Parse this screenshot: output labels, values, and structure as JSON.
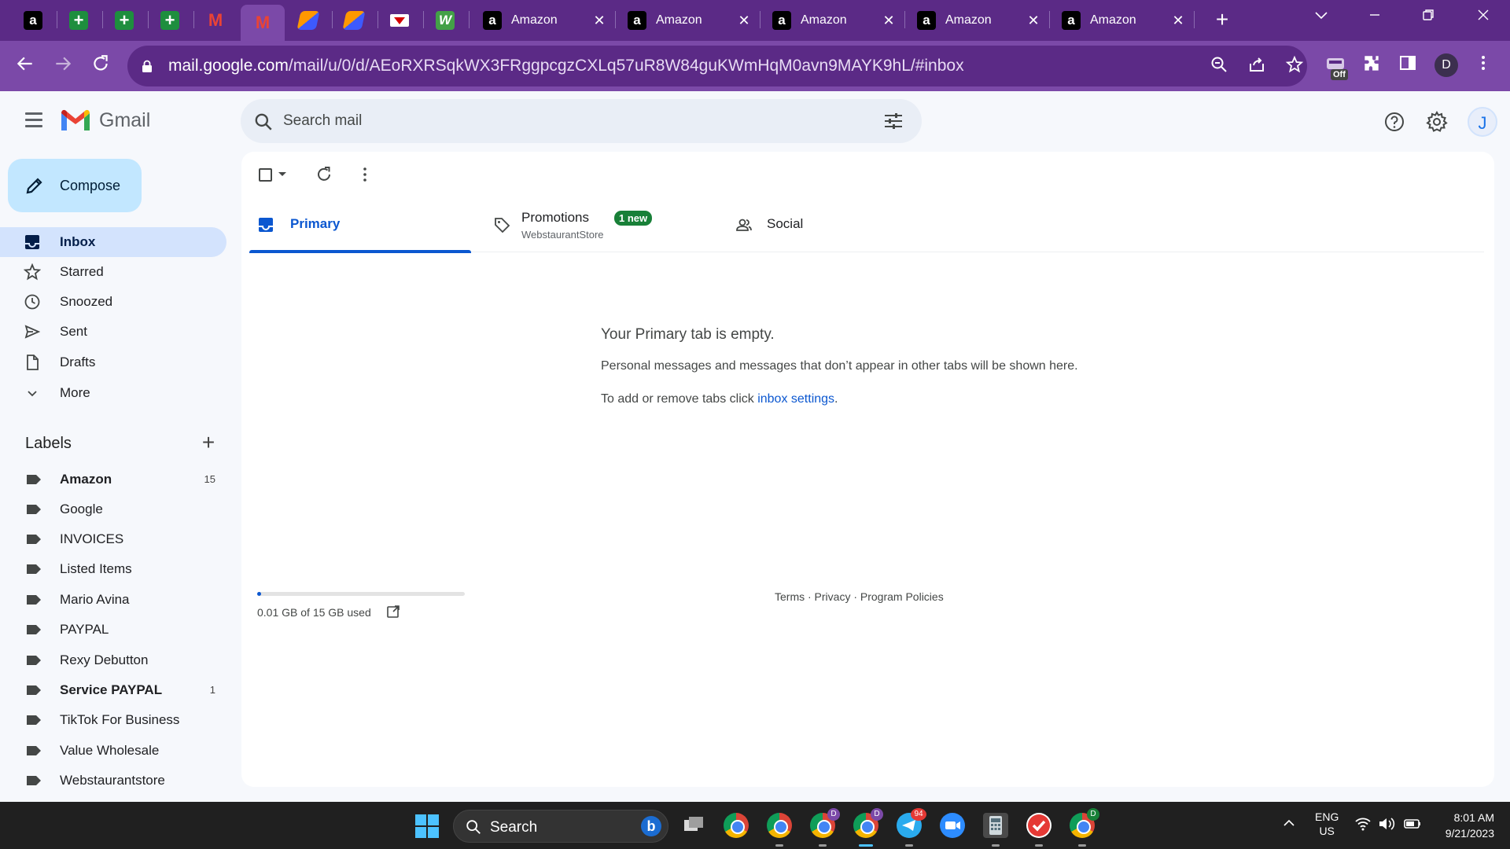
{
  "browser": {
    "tabs": [
      {
        "icon": "amazon-favicon",
        "label": ""
      },
      {
        "icon": "sheets-favicon",
        "label": ""
      },
      {
        "icon": "sheets-favicon",
        "label": ""
      },
      {
        "icon": "sheets-favicon",
        "label": ""
      },
      {
        "icon": "gmail-favicon",
        "label": ""
      },
      {
        "icon": "gmail-favicon",
        "label": "",
        "active": true
      },
      {
        "icon": "orange-app-favicon",
        "label": ""
      },
      {
        "icon": "orange-app-favicon",
        "label": ""
      },
      {
        "icon": "red-logo-favicon",
        "label": ""
      },
      {
        "icon": "green-w-favicon",
        "label": ""
      },
      {
        "icon": "amazon-favicon",
        "label": "Amazon"
      },
      {
        "icon": "amazon-favicon",
        "label": "Amazon"
      },
      {
        "icon": "amazon-favicon",
        "label": "Amazon"
      },
      {
        "icon": "amazon-favicon",
        "label": "Amazon"
      },
      {
        "icon": "amazon-favicon",
        "label": "Amazon"
      }
    ],
    "address": {
      "host": "mail.google.com",
      "path": "/mail/u/0/d/AEoRXRSqkWX3FRggpcgzCXLq57uR8W84guKWmHqM0avn9MAYK9hL/#inbox"
    },
    "extension_badge": "Off",
    "profile_initial": "D",
    "colors": {
      "frame": "#5b2a86",
      "toolbar": "#7b49a8"
    }
  },
  "gmail": {
    "brand": "Gmail",
    "search_placeholder": "Search mail",
    "account_initial": "J",
    "compose_label": "Compose",
    "nav": [
      {
        "label": "Inbox",
        "icon": "inbox-icon",
        "active": true
      },
      {
        "label": "Starred",
        "icon": "star-icon"
      },
      {
        "label": "Snoozed",
        "icon": "clock-icon"
      },
      {
        "label": "Sent",
        "icon": "send-icon"
      },
      {
        "label": "Drafts",
        "icon": "draft-icon"
      },
      {
        "label": "More",
        "icon": "chevron-down-icon"
      }
    ],
    "labels_title": "Labels",
    "labels": [
      {
        "name": "Amazon",
        "count": "15",
        "bold": true
      },
      {
        "name": "Google",
        "count": ""
      },
      {
        "name": "INVOICES",
        "count": ""
      },
      {
        "name": "Listed Items",
        "count": ""
      },
      {
        "name": "Mario Avina",
        "count": ""
      },
      {
        "name": "PAYPAL",
        "count": ""
      },
      {
        "name": "Rexy Debutton",
        "count": ""
      },
      {
        "name": "Service PAYPAL",
        "count": "1",
        "bold": true
      },
      {
        "name": "TikTok For Business",
        "count": ""
      },
      {
        "name": "Value Wholesale",
        "count": ""
      },
      {
        "name": "Webstaurantstore",
        "count": ""
      }
    ],
    "tabs": {
      "primary": "Primary",
      "promotions": "Promotions",
      "promotions_badge": "1 new",
      "promotions_sender": "WebstaurantStore",
      "social": "Social"
    },
    "empty": {
      "title": "Your Primary tab is empty.",
      "description": "Personal messages and messages that don’t appear in other tabs will be shown here.",
      "settings_prefix": "To add or remove tabs click ",
      "settings_link": "inbox settings",
      "settings_suffix": "."
    },
    "storage": {
      "text": "0.01 GB of 15 GB used",
      "used_fraction": 0.0007
    },
    "footer": "Terms · Privacy · Program Policies"
  },
  "taskbar": {
    "search_label": "Search",
    "telegram_badge": "94",
    "language": "ENG",
    "region": "US",
    "time": "8:01 AM",
    "date": "9/21/2023"
  }
}
